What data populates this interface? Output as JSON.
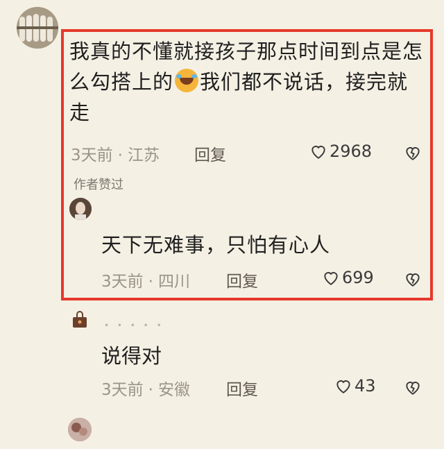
{
  "comments": [
    {
      "text_parts": [
        "我真的不懂就接孩子那点时间到点是怎么勾搭上的",
        "我们都不说话，接完就走"
      ],
      "emoji": "laughing-crying-emoji",
      "time": "3天前",
      "location": "江苏",
      "reply": "回复",
      "likes": "2968",
      "badge": "作者赞过"
    },
    {
      "text": "天下无难事，只怕有心人",
      "time": "3天前",
      "location": "四川",
      "reply": "回复",
      "likes": "699"
    },
    {
      "text": "说得对",
      "time": "3天前",
      "location": "安徽",
      "reply": "回复",
      "likes": "43"
    }
  ],
  "colors": {
    "highlight": "#e5392c",
    "background": "#f5f0e4"
  }
}
